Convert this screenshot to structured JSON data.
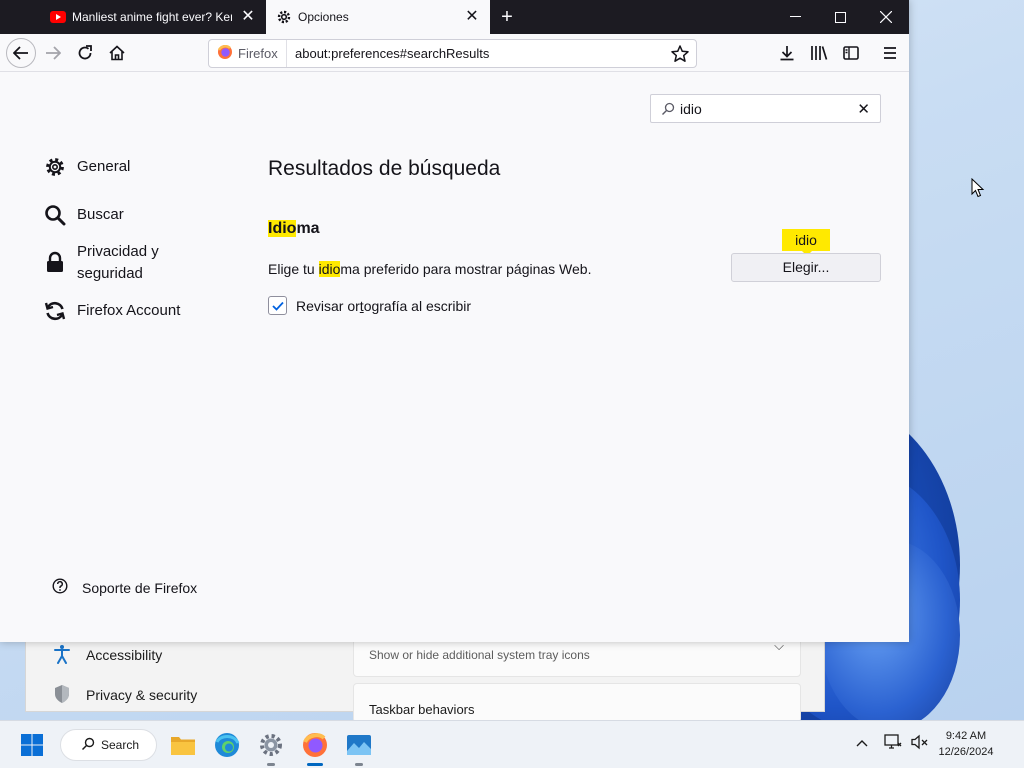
{
  "browser": {
    "tabs": [
      {
        "label": "Manliest anime fight ever? Ken",
        "icon": "youtube-icon",
        "active": false
      },
      {
        "label": "Opciones",
        "icon": "gear-icon",
        "active": true
      }
    ],
    "url_identity": "Firefox",
    "url": "about:preferences#searchResults"
  },
  "preferences": {
    "search_value": "idio",
    "nav": [
      {
        "label": "General",
        "icon": "gear-icon"
      },
      {
        "label": "Buscar",
        "icon": "search-icon"
      },
      {
        "label": "Privacidad y seguridad",
        "icon": "lock-icon"
      },
      {
        "label": "Firefox Account",
        "icon": "sync-icon"
      }
    ],
    "support_label": "Soporte de Firefox",
    "results_title": "Resultados de búsqueda",
    "section": {
      "title_highlight": "Idio",
      "title_rest": "ma",
      "desc_before": "Elige tu ",
      "desc_highlight": "idio",
      "desc_after": "ma preferido para mostrar páginas Web.",
      "checkbox_before": "Revisar or",
      "checkbox_underlined": "t",
      "checkbox_after": "ografía al escribir",
      "checkbox_checked": true,
      "tooltip": "idio",
      "button_label": "Elegir..."
    }
  },
  "background_window": {
    "nav": [
      {
        "label": "Accessibility",
        "icon": "accessibility-icon"
      },
      {
        "label": "Privacy & security",
        "icon": "shield-icon"
      }
    ],
    "card_subtitle": "Show or hide additional system tray icons",
    "card_title": "Taskbar behaviors"
  },
  "taskbar": {
    "search_label": "Search",
    "time": "9:42 AM",
    "date": "12/26/2024"
  },
  "colors": {
    "highlight": "#ffe900",
    "tabbar": "#1c1b22",
    "accent": "#0061e0"
  }
}
